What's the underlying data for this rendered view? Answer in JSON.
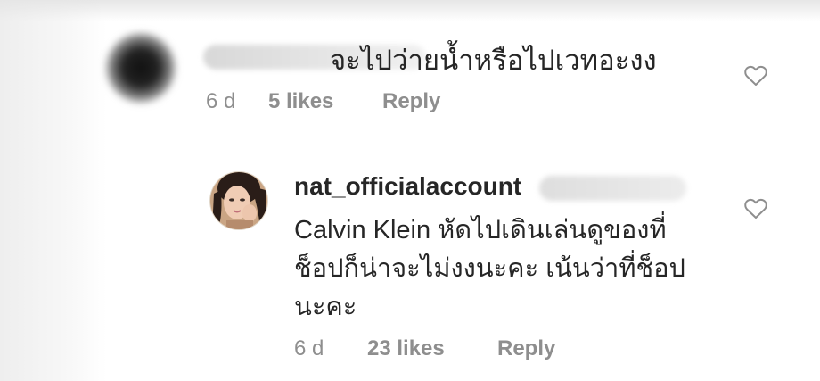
{
  "comments": [
    {
      "text": "จะไปว่ายน้ำหรือไปเวทอะงง",
      "time": "6 d",
      "likes": "5 likes",
      "reply_label": "Reply"
    }
  ],
  "reply": {
    "username": "nat_officialaccount",
    "lines": [
      "Calvin Klein หัดไปเดินเล่นดูของที่",
      "ช็อปก็น่าจะไม่งงนะคะ เน้นว่าที่ช็อป",
      "นะคะ"
    ],
    "time": "6 d",
    "likes": "23 likes",
    "reply_label": "Reply"
  },
  "icons": {
    "like": "heart-outline-icon"
  },
  "colors": {
    "text": "#262626",
    "meta": "#8e8e8e",
    "background": "#ffffff"
  }
}
